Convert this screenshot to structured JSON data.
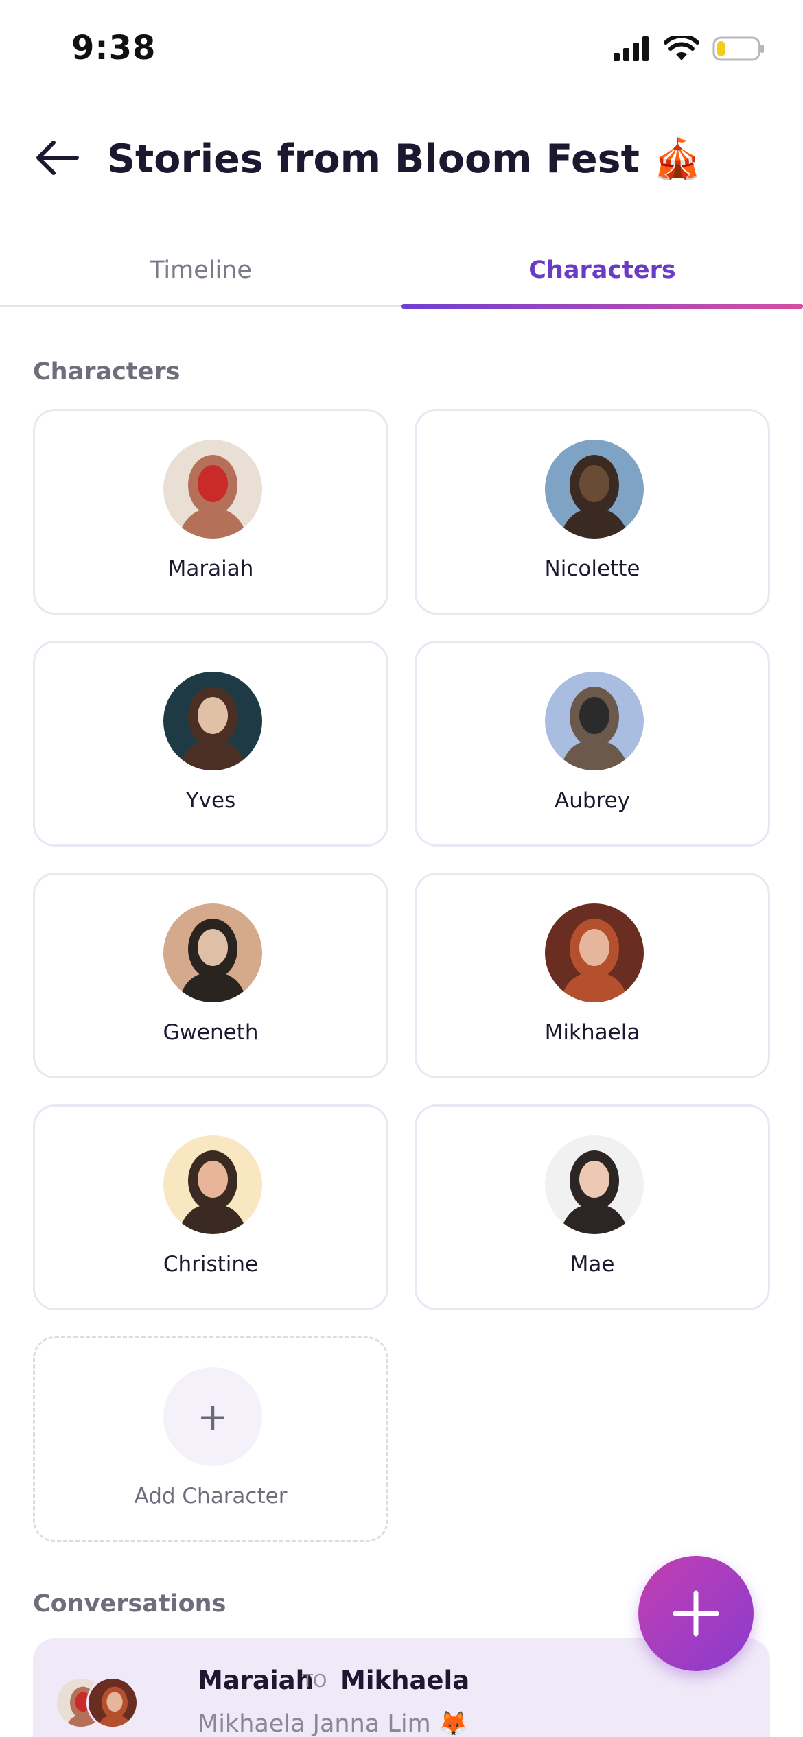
{
  "status_bar": {
    "time": "9:38",
    "battery_level": 0.2
  },
  "header": {
    "title": "Stories from Bloom Fest 🎪",
    "back_icon": "arrow-left-icon"
  },
  "tabs": [
    {
      "label": "Timeline",
      "active": false
    },
    {
      "label": "Characters",
      "active": true
    }
  ],
  "characters_section": {
    "title": "Characters",
    "items": [
      {
        "name": "Maraiah",
        "avatar_colors": [
          "#e9dfd4",
          "#b5705a",
          "#c92a2a"
        ]
      },
      {
        "name": "Nicolette",
        "avatar_colors": [
          "#7ea3c4",
          "#3b2a22",
          "#6a4b36"
        ]
      },
      {
        "name": "Yves",
        "avatar_colors": [
          "#1e3b45",
          "#4b2f24",
          "#e1c1a6"
        ]
      },
      {
        "name": "Aubrey",
        "avatar_colors": [
          "#a9bde0",
          "#6b5a4b",
          "#2b2b2b"
        ]
      },
      {
        "name": "Gweneth",
        "avatar_colors": [
          "#d5a98c",
          "#2a2420",
          "#e0bfa7"
        ]
      },
      {
        "name": "Mikhaela",
        "avatar_colors": [
          "#6a2d22",
          "#b5502f",
          "#e6b69c"
        ]
      },
      {
        "name": "Christine",
        "avatar_colors": [
          "#f8e7c0",
          "#3a2a22",
          "#e8b49a"
        ]
      },
      {
        "name": "Mae",
        "avatar_colors": [
          "#f1f1f1",
          "#2b2524",
          "#edc8b2"
        ]
      }
    ],
    "add_label": "Add Character",
    "add_symbol": "+"
  },
  "conversations_section": {
    "title": "Conversations",
    "items": [
      {
        "from": "Maraiah",
        "to_label": "TO",
        "recipient": "Mikhaela",
        "subtitle": "Mikhaela Janna Lim 🦊"
      }
    ]
  },
  "fab": {
    "icon": "plus-icon"
  },
  "colors": {
    "accent": "#6a3bc4",
    "accent_pink": "#d54fa2",
    "card_border": "#eae7f3",
    "conversation_bg": "#f0eaf8"
  }
}
